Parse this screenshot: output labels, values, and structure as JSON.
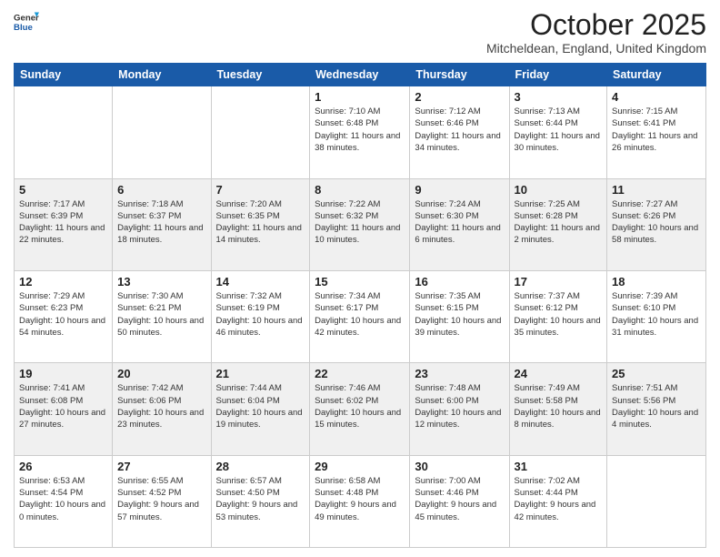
{
  "header": {
    "logo_line1": "General",
    "logo_line2": "Blue",
    "month": "October 2025",
    "location": "Mitcheldean, England, United Kingdom"
  },
  "weekdays": [
    "Sunday",
    "Monday",
    "Tuesday",
    "Wednesday",
    "Thursday",
    "Friday",
    "Saturday"
  ],
  "weeks": [
    [
      {
        "day": "",
        "sunrise": "",
        "sunset": "",
        "daylight": ""
      },
      {
        "day": "",
        "sunrise": "",
        "sunset": "",
        "daylight": ""
      },
      {
        "day": "",
        "sunrise": "",
        "sunset": "",
        "daylight": ""
      },
      {
        "day": "1",
        "sunrise": "Sunrise: 7:10 AM",
        "sunset": "Sunset: 6:48 PM",
        "daylight": "Daylight: 11 hours and 38 minutes."
      },
      {
        "day": "2",
        "sunrise": "Sunrise: 7:12 AM",
        "sunset": "Sunset: 6:46 PM",
        "daylight": "Daylight: 11 hours and 34 minutes."
      },
      {
        "day": "3",
        "sunrise": "Sunrise: 7:13 AM",
        "sunset": "Sunset: 6:44 PM",
        "daylight": "Daylight: 11 hours and 30 minutes."
      },
      {
        "day": "4",
        "sunrise": "Sunrise: 7:15 AM",
        "sunset": "Sunset: 6:41 PM",
        "daylight": "Daylight: 11 hours and 26 minutes."
      }
    ],
    [
      {
        "day": "5",
        "sunrise": "Sunrise: 7:17 AM",
        "sunset": "Sunset: 6:39 PM",
        "daylight": "Daylight: 11 hours and 22 minutes."
      },
      {
        "day": "6",
        "sunrise": "Sunrise: 7:18 AM",
        "sunset": "Sunset: 6:37 PM",
        "daylight": "Daylight: 11 hours and 18 minutes."
      },
      {
        "day": "7",
        "sunrise": "Sunrise: 7:20 AM",
        "sunset": "Sunset: 6:35 PM",
        "daylight": "Daylight: 11 hours and 14 minutes."
      },
      {
        "day": "8",
        "sunrise": "Sunrise: 7:22 AM",
        "sunset": "Sunset: 6:32 PM",
        "daylight": "Daylight: 11 hours and 10 minutes."
      },
      {
        "day": "9",
        "sunrise": "Sunrise: 7:24 AM",
        "sunset": "Sunset: 6:30 PM",
        "daylight": "Daylight: 11 hours and 6 minutes."
      },
      {
        "day": "10",
        "sunrise": "Sunrise: 7:25 AM",
        "sunset": "Sunset: 6:28 PM",
        "daylight": "Daylight: 11 hours and 2 minutes."
      },
      {
        "day": "11",
        "sunrise": "Sunrise: 7:27 AM",
        "sunset": "Sunset: 6:26 PM",
        "daylight": "Daylight: 10 hours and 58 minutes."
      }
    ],
    [
      {
        "day": "12",
        "sunrise": "Sunrise: 7:29 AM",
        "sunset": "Sunset: 6:23 PM",
        "daylight": "Daylight: 10 hours and 54 minutes."
      },
      {
        "day": "13",
        "sunrise": "Sunrise: 7:30 AM",
        "sunset": "Sunset: 6:21 PM",
        "daylight": "Daylight: 10 hours and 50 minutes."
      },
      {
        "day": "14",
        "sunrise": "Sunrise: 7:32 AM",
        "sunset": "Sunset: 6:19 PM",
        "daylight": "Daylight: 10 hours and 46 minutes."
      },
      {
        "day": "15",
        "sunrise": "Sunrise: 7:34 AM",
        "sunset": "Sunset: 6:17 PM",
        "daylight": "Daylight: 10 hours and 42 minutes."
      },
      {
        "day": "16",
        "sunrise": "Sunrise: 7:35 AM",
        "sunset": "Sunset: 6:15 PM",
        "daylight": "Daylight: 10 hours and 39 minutes."
      },
      {
        "day": "17",
        "sunrise": "Sunrise: 7:37 AM",
        "sunset": "Sunset: 6:12 PM",
        "daylight": "Daylight: 10 hours and 35 minutes."
      },
      {
        "day": "18",
        "sunrise": "Sunrise: 7:39 AM",
        "sunset": "Sunset: 6:10 PM",
        "daylight": "Daylight: 10 hours and 31 minutes."
      }
    ],
    [
      {
        "day": "19",
        "sunrise": "Sunrise: 7:41 AM",
        "sunset": "Sunset: 6:08 PM",
        "daylight": "Daylight: 10 hours and 27 minutes."
      },
      {
        "day": "20",
        "sunrise": "Sunrise: 7:42 AM",
        "sunset": "Sunset: 6:06 PM",
        "daylight": "Daylight: 10 hours and 23 minutes."
      },
      {
        "day": "21",
        "sunrise": "Sunrise: 7:44 AM",
        "sunset": "Sunset: 6:04 PM",
        "daylight": "Daylight: 10 hours and 19 minutes."
      },
      {
        "day": "22",
        "sunrise": "Sunrise: 7:46 AM",
        "sunset": "Sunset: 6:02 PM",
        "daylight": "Daylight: 10 hours and 15 minutes."
      },
      {
        "day": "23",
        "sunrise": "Sunrise: 7:48 AM",
        "sunset": "Sunset: 6:00 PM",
        "daylight": "Daylight: 10 hours and 12 minutes."
      },
      {
        "day": "24",
        "sunrise": "Sunrise: 7:49 AM",
        "sunset": "Sunset: 5:58 PM",
        "daylight": "Daylight: 10 hours and 8 minutes."
      },
      {
        "day": "25",
        "sunrise": "Sunrise: 7:51 AM",
        "sunset": "Sunset: 5:56 PM",
        "daylight": "Daylight: 10 hours and 4 minutes."
      }
    ],
    [
      {
        "day": "26",
        "sunrise": "Sunrise: 6:53 AM",
        "sunset": "Sunset: 4:54 PM",
        "daylight": "Daylight: 10 hours and 0 minutes."
      },
      {
        "day": "27",
        "sunrise": "Sunrise: 6:55 AM",
        "sunset": "Sunset: 4:52 PM",
        "daylight": "Daylight: 9 hours and 57 minutes."
      },
      {
        "day": "28",
        "sunrise": "Sunrise: 6:57 AM",
        "sunset": "Sunset: 4:50 PM",
        "daylight": "Daylight: 9 hours and 53 minutes."
      },
      {
        "day": "29",
        "sunrise": "Sunrise: 6:58 AM",
        "sunset": "Sunset: 4:48 PM",
        "daylight": "Daylight: 9 hours and 49 minutes."
      },
      {
        "day": "30",
        "sunrise": "Sunrise: 7:00 AM",
        "sunset": "Sunset: 4:46 PM",
        "daylight": "Daylight: 9 hours and 45 minutes."
      },
      {
        "day": "31",
        "sunrise": "Sunrise: 7:02 AM",
        "sunset": "Sunset: 4:44 PM",
        "daylight": "Daylight: 9 hours and 42 minutes."
      },
      {
        "day": "",
        "sunrise": "",
        "sunset": "",
        "daylight": ""
      }
    ]
  ]
}
